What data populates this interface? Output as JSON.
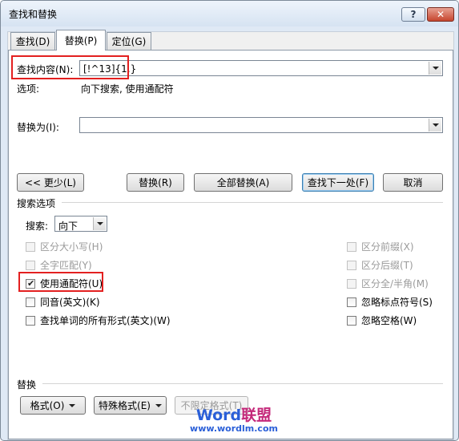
{
  "window": {
    "title": "查找和替换",
    "help_label": "?",
    "close_label": "✕"
  },
  "tabs": [
    {
      "label": "查找(D)"
    },
    {
      "label": "替换(P)"
    },
    {
      "label": "定位(G)"
    }
  ],
  "find": {
    "label": "查找内容(N):",
    "value": "[!^13]{1,}"
  },
  "options": {
    "label": "选项:",
    "value": "向下搜索, 使用通配符"
  },
  "replace": {
    "label": "替换为(I):",
    "value": ""
  },
  "buttons": {
    "less": "<< 更少(L)",
    "replace": "替换(R)",
    "replace_all": "全部替换(A)",
    "find_next": "查找下一处(F)",
    "cancel": "取消"
  },
  "search_options": {
    "header": "搜索选项",
    "search_label": "搜索:",
    "search_value": "向下",
    "left": [
      {
        "label": "区分大小写(H)",
        "checked": false,
        "disabled": true
      },
      {
        "label": "全字匹配(Y)",
        "checked": false,
        "disabled": true
      },
      {
        "label": "使用通配符(U)",
        "checked": true,
        "disabled": false
      },
      {
        "label": "同音(英文)(K)",
        "checked": false,
        "disabled": false
      },
      {
        "label": "查找单词的所有形式(英文)(W)",
        "checked": false,
        "disabled": false
      }
    ],
    "right": [
      {
        "label": "区分前缀(X)",
        "checked": false,
        "disabled": true
      },
      {
        "label": "区分后缀(T)",
        "checked": false,
        "disabled": true
      },
      {
        "label": "区分全/半角(M)",
        "checked": false,
        "disabled": true
      },
      {
        "label": "忽略标点符号(S)",
        "checked": false,
        "disabled": false
      },
      {
        "label": "忽略空格(W)",
        "checked": false,
        "disabled": false
      }
    ]
  },
  "replace_section": {
    "header": "替换",
    "format": "格式(O)",
    "special": "特殊格式(E)",
    "no_format": "不限定格式(T)"
  },
  "watermark": {
    "brand_latin": "Word",
    "brand_cjk": "联盟",
    "url": "www.wordlm.com"
  },
  "colors": {
    "highlight_red": "#e32020",
    "watermark_blue": "#2a5fd8",
    "watermark_pink": "#c4287a"
  }
}
